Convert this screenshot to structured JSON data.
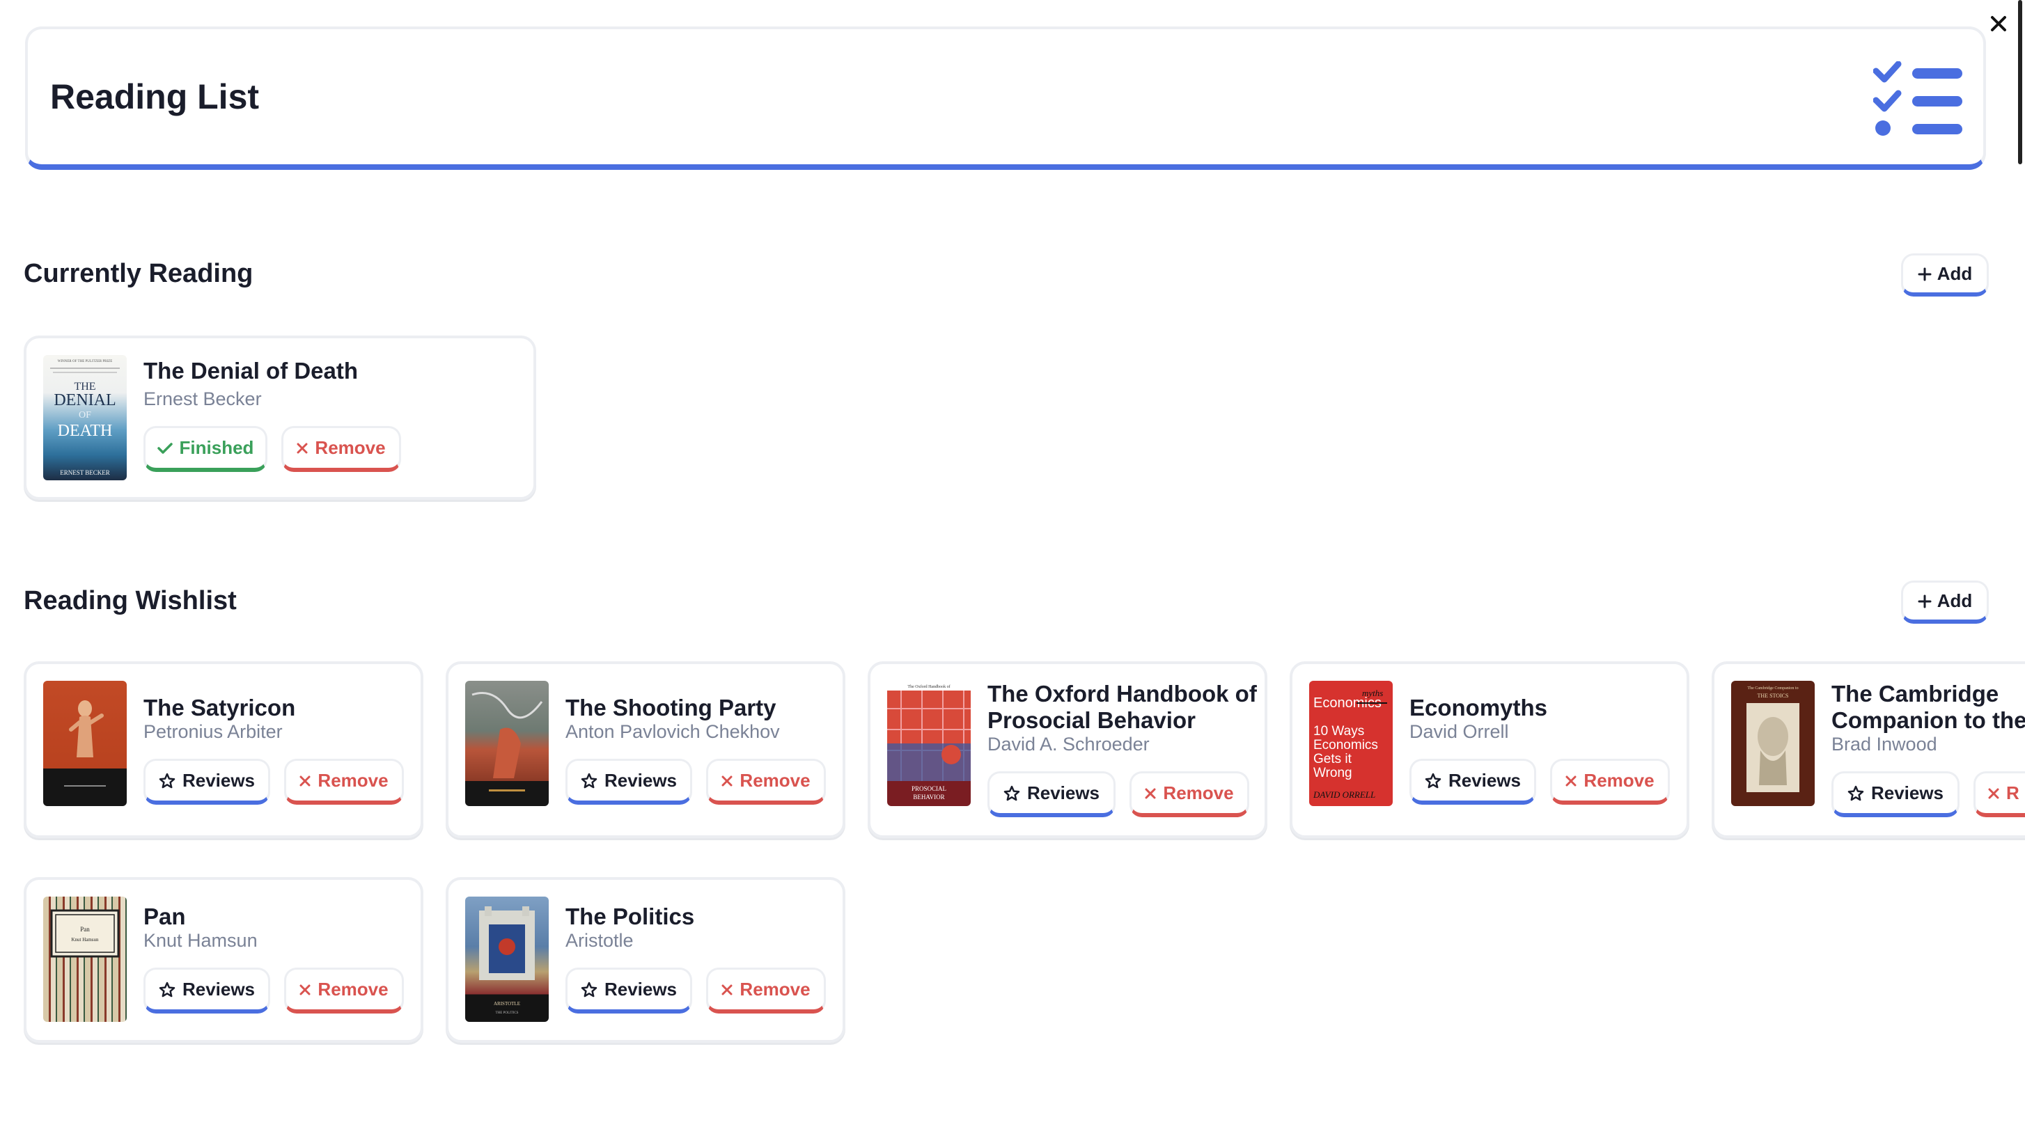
{
  "header": {
    "title": "Reading List"
  },
  "currently_reading": {
    "title": "Currently Reading",
    "add_label": "Add",
    "books": [
      {
        "title": "The Denial of Death",
        "author": "Ernest Becker",
        "finished_label": "Finished",
        "remove_label": "Remove",
        "cover_lines": [
          "WINNER OF THE PULITZER PRIZE",
          "THE",
          "DENIAL",
          "OF",
          "DEATH",
          "ERNEST BECKER"
        ]
      }
    ]
  },
  "wishlist": {
    "title": "Reading Wishlist",
    "add_label": "Add",
    "books": [
      {
        "title": "The Satyricon",
        "author": "Petronius Arbiter",
        "reviews_label": "Reviews",
        "remove_label": "Remove"
      },
      {
        "title": "The Shooting Party",
        "author": "Anton Pavlovich Chekhov",
        "reviews_label": "Reviews",
        "remove_label": "Remove"
      },
      {
        "title_line1": "The Oxford Handbook of",
        "title_line2": "Prosocial Behavior",
        "author": "David A. Schroeder",
        "reviews_label": "Reviews",
        "remove_label": "Remove",
        "cover_lines": [
          "The Oxford Handbook of",
          "PROSOCIAL",
          "BEHAVIOR"
        ]
      },
      {
        "title": "Economyths",
        "author": "David Orrell",
        "reviews_label": "Reviews",
        "remove_label": "Remove",
        "cover_lines": [
          "Economics",
          "myths",
          "10 Ways",
          "Economics",
          "Gets it",
          "Wrong",
          "DAVID ORRELL"
        ]
      },
      {
        "title_line1": "The Cambridge",
        "title_line2": "Companion to the",
        "author": "Brad Inwood",
        "reviews_label": "Reviews",
        "remove_label": "R",
        "cover_lines": [
          "The Cambridge Companion to",
          "THE STOICS"
        ]
      },
      {
        "title": "Pan",
        "author": "Knut Hamsun",
        "reviews_label": "Reviews",
        "remove_label": "Remove",
        "cover_lines": [
          "Pan",
          "Knut Hamsun"
        ]
      },
      {
        "title": "The Politics",
        "author": "Aristotle",
        "reviews_label": "Reviews",
        "remove_label": "Remove",
        "cover_lines": [
          "ARISTOTLE",
          "THE POLITICS"
        ]
      }
    ]
  },
  "colors": {
    "accent": "#4a6ee0",
    "danger": "#d9534f",
    "success": "#3aa05a",
    "text": "#1a1d2b",
    "muted": "#7a8296"
  },
  "icons": {
    "close": "close-icon",
    "list": "checklist-icon",
    "plus": "plus-icon",
    "star": "star-icon",
    "check": "check-icon",
    "x": "x-icon"
  }
}
